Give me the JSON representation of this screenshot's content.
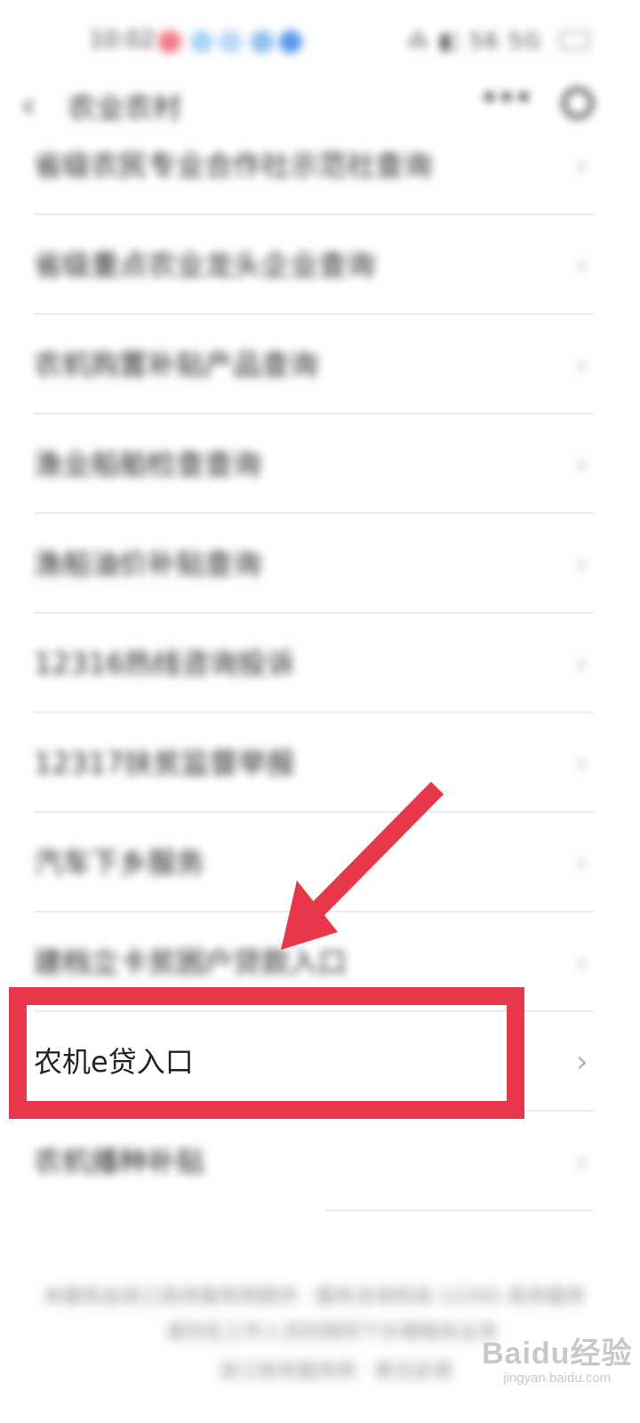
{
  "status_bar": {
    "time": "10:02",
    "system_icons": "⁂ ◧ 56 5G"
  },
  "header": {
    "title": "农业农村",
    "more_icon": "more-icon",
    "close_icon": "close-icon"
  },
  "list": {
    "items": [
      {
        "label": "省级农民专业合作社示范社查询"
      },
      {
        "label": "省级重点农业龙头企业查询"
      },
      {
        "label": "农机购置补贴产品查询"
      },
      {
        "label": "渔业船舶检查查询"
      },
      {
        "label": "渔船油价补贴查询"
      },
      {
        "label": "12316热线咨询投诉"
      },
      {
        "label": "12317扶贫监督举报"
      },
      {
        "label": "汽车下乡服务"
      },
      {
        "label": "建档立卡贫困户贷款入口"
      },
      {
        "label": "农机e贷入口"
      },
      {
        "label": "农机播种补贴"
      }
    ]
  },
  "footer": {
    "line1": "本服务由浙江政务服务网提供 · 服务咨询热线 12345 政务服务",
    "line2": "请勿在工作人员的陪同下办理相关业务",
    "line3": "浙江政务服务网 · 意见反馈"
  },
  "watermark": {
    "main": "Baidu经验",
    "sub": "jingyan.baidu.com"
  },
  "colors": {
    "annotation": "#e8374b",
    "chevron": "#b0b0b0"
  }
}
